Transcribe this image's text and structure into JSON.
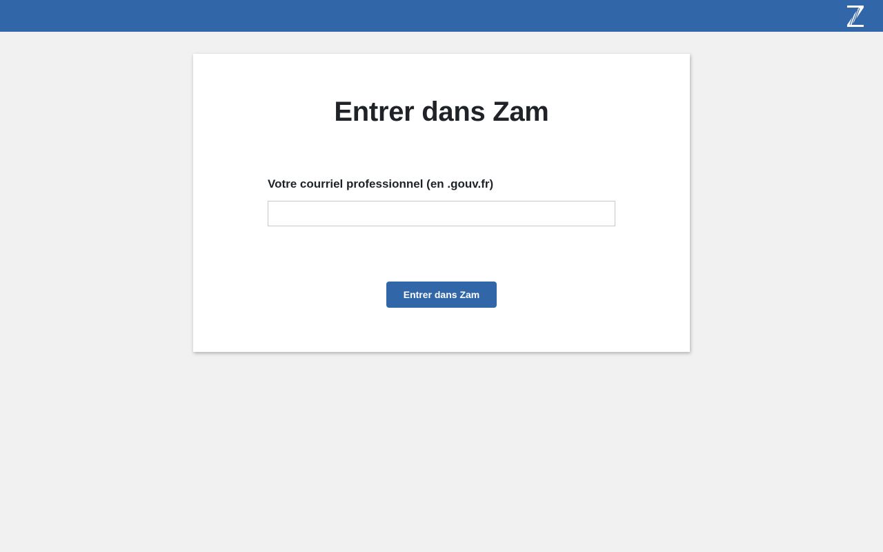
{
  "header": {
    "logo_icon": "zam-z-logo-icon",
    "logo_text": "Z",
    "background_color": "#3167a8"
  },
  "login": {
    "title": "Entrer dans Zam",
    "email_label": "Votre courriel professionnel (en .gouv.fr)",
    "email_value": "",
    "email_placeholder": "",
    "submit_label": "Entrer dans Zam"
  },
  "colors": {
    "accent": "#3167a8",
    "page_background": "#f1f1f1",
    "card_background": "#ffffff",
    "text": "#1f2328"
  }
}
